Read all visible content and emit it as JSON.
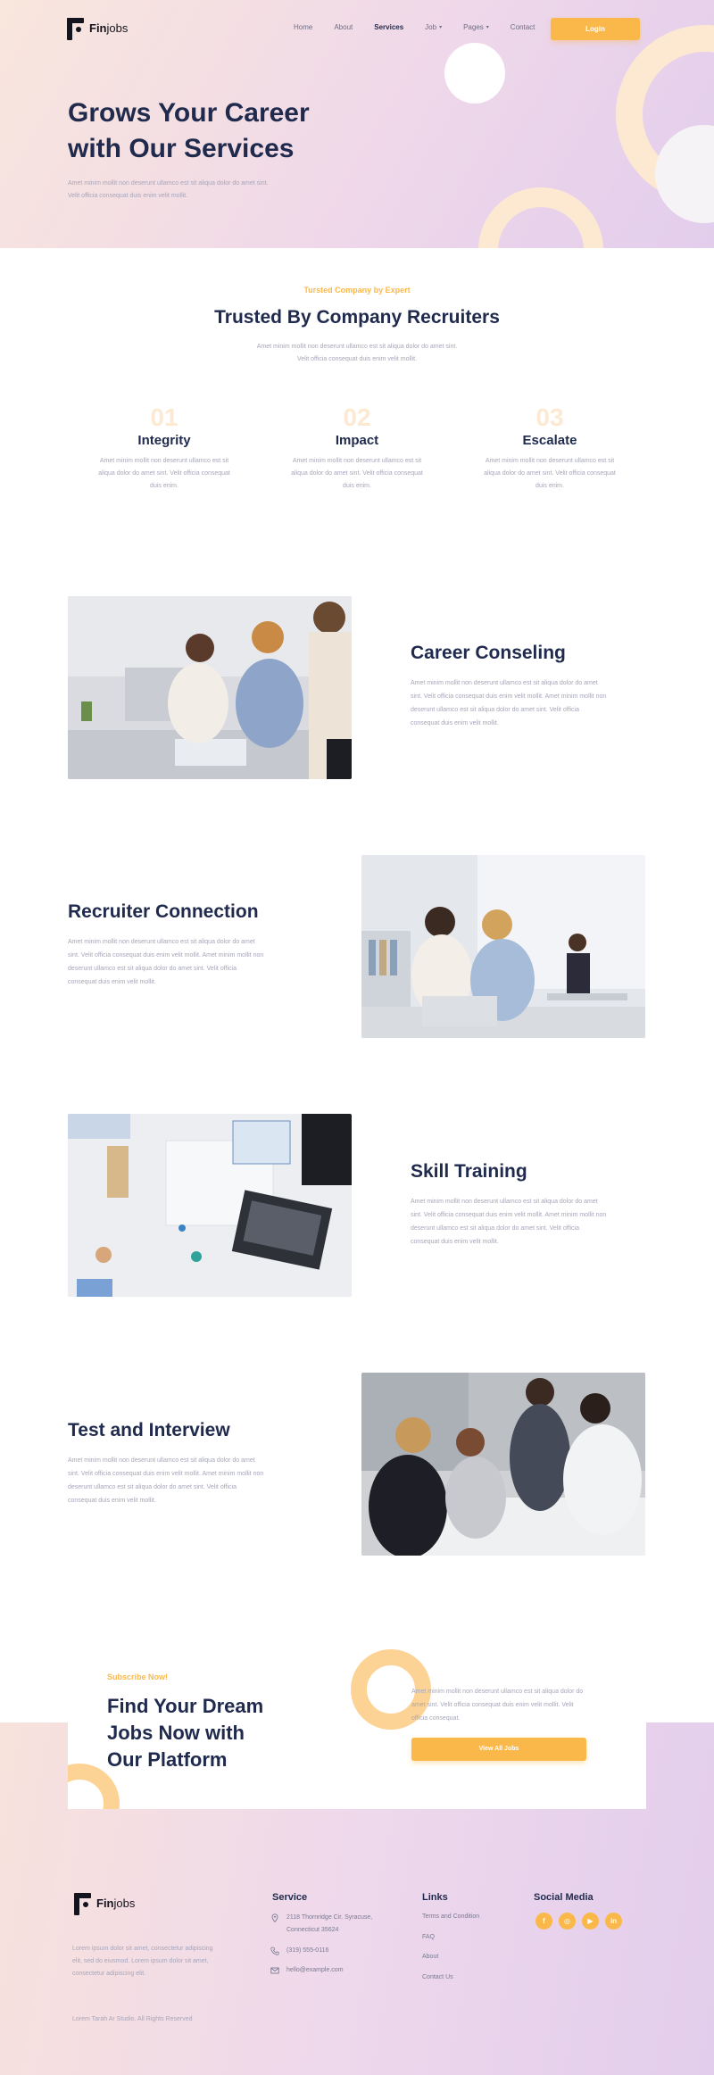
{
  "brand": {
    "name_bold": "Fin",
    "name_rest": "jobs"
  },
  "nav": {
    "items": [
      {
        "label": "Home",
        "caret": false,
        "active": false
      },
      {
        "label": "About",
        "caret": false,
        "active": false
      },
      {
        "label": "Services",
        "caret": false,
        "active": true
      },
      {
        "label": "Job",
        "caret": true,
        "active": false
      },
      {
        "label": "Pages",
        "caret": true,
        "active": false
      },
      {
        "label": "Contact",
        "caret": false,
        "active": false
      }
    ],
    "login_label": "Login"
  },
  "hero": {
    "title_line1": "Grows Your Career",
    "title_line2": "with Our Services",
    "text": "Amet minim mollit non deserunt ullamco est sit aliqua dolor do amet sint. Velit officia consequat duis enim velit mollit."
  },
  "trusted": {
    "eyebrow": "Tursted Company by Expert",
    "title": "Trusted By Company Recruiters",
    "text": "Amet minim mollit non deserunt ullamco est sit aliqua dolor do amet sint. Velit officia consequat duis enim velit mollit.",
    "features": [
      {
        "num": "01",
        "title": "Integrity",
        "text": "Amet minim mollit non deserunt ullamco est sit aliqua dolor do amet sint. Velit officia consequat duis enim."
      },
      {
        "num": "02",
        "title": "Impact",
        "text": "Amet minim mollit non deserunt ullamco est sit aliqua dolor do amet sint. Velit officia consequat duis enim."
      },
      {
        "num": "03",
        "title": "Escalate",
        "text": "Amet minim mollit non deserunt ullamco est sit aliqua dolor do amet sint. Velit officia consequat duis enim."
      }
    ]
  },
  "services": [
    {
      "title": "Career Conseling",
      "text": "Amet minim mollit non deserunt ullamco est sit aliqua dolor do amet sint. Velit officia consequat duis enim velit mollit. Amet minim mollit non deserunt ullamco est sit aliqua dolor do amet sint. Velit officia consequat duis enim velit mollit."
    },
    {
      "title": "Recruiter Connection",
      "text": "Amet minim mollit non deserunt ullamco est sit aliqua dolor do amet sint. Velit officia consequat duis enim velit mollit. Amet minim mollit non deserunt ullamco est sit aliqua dolor do amet sint. Velit officia consequat duis enim velit mollit."
    },
    {
      "title": "Skill Training",
      "text": "Amet minim mollit non deserunt ullamco est sit aliqua dolor do amet sint. Velit officia consequat duis enim velit mollit. Amet minim mollit non deserunt ullamco est sit aliqua dolor do amet sint. Velit officia consequat duis enim velit mollit."
    },
    {
      "title": "Test and Interview",
      "text": "Amet minim mollit non deserunt ullamco est sit aliqua dolor do amet sint. Velit officia consequat duis enim velit mollit. Amet minim mollit non deserunt ullamco est sit aliqua dolor do amet sint. Velit officia consequat duis enim velit mollit."
    }
  ],
  "subscribe": {
    "eyebrow": "Subscribe Now!",
    "title_line1": "Find Your Dream",
    "title_line2": "Jobs Now with",
    "title_line3": "Our Platform",
    "text": "Amet minim mollit non deserunt ullamco est sit aliqua dolor do amet sint. Velit officia consequat duis enim velit mollit. Velit officia consequat.",
    "button_label": "View All Jobs"
  },
  "footer": {
    "about": "Lorem ipsum dolor sit amet, consectetur adipiscing elit, sed do eiusmod. Lorem ipsum dolor sit amet, consectetur adipiscing elit.",
    "service_heading": "Service",
    "address_line1": "2118 Thornridge Cir. Syracuse,",
    "address_line2": "Connecticut 35624",
    "phone": "(319) 555-0116",
    "email": "hello@example.com",
    "links_heading": "Links",
    "links": [
      "Terms and Condition",
      "FAQ",
      "About",
      "Contact Us"
    ],
    "social_heading": "Social Media",
    "social": [
      {
        "name": "facebook-icon",
        "glyph": "f"
      },
      {
        "name": "instagram-icon",
        "glyph": "◎"
      },
      {
        "name": "youtube-icon",
        "glyph": "▶"
      },
      {
        "name": "linkedin-icon",
        "glyph": "in"
      }
    ],
    "copyright": "Lorem Tarah Ar Studio. All Rights Reserved"
  },
  "colors": {
    "accent": "#fbb84a",
    "navy": "#1f2a4d",
    "muted": "#a6a6ba",
    "peach": "#fde9d2"
  }
}
